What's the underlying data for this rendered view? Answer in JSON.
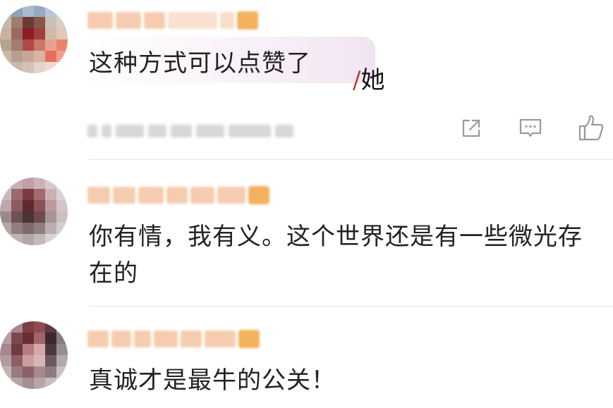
{
  "comments": [
    {
      "text": "这种方式可以点赞了",
      "mark": "她"
    },
    {
      "text_line1": "你有情，我有义。这个世界还是有一些微光存",
      "text_line2": "在的"
    },
    {
      "text": "真诚才是最牛的公关！"
    }
  ],
  "actions": {
    "share_icon": "share-icon",
    "comment_icon": "comment-icon",
    "like_icon": "like-icon"
  },
  "colors": {
    "text": "#222222",
    "divider": "#e5e5e5",
    "icon": "#9a9a9a"
  }
}
